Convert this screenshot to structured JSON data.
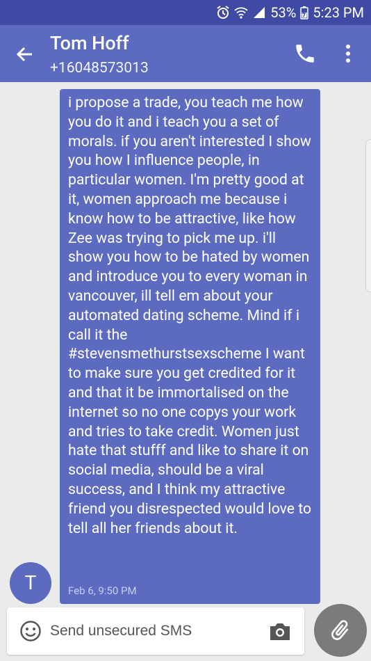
{
  "status_bar": {
    "battery": "53%",
    "time": "5:23 PM",
    "icons": [
      "alarm-icon",
      "wifi-icon",
      "signal-icon",
      "battery-icon"
    ]
  },
  "app_bar": {
    "contact_name": "Tom Hoff",
    "phone_number": "+16048573013",
    "icons": [
      "back-arrow-icon",
      "phone-icon",
      "more-vert-icon"
    ]
  },
  "message": {
    "text": "i propose a trade, you teach me how you do it and i teach you a set of morals. if you aren't interested I show you how I influence people, in particular women. I'm pretty good at it, women approach me because i know how to be attractive, like how Zee was trying to pick me up. i'll show you how to be hated by women and introduce you to every woman in vancouver, ill tell em about your automated dating scheme. Mind if i call it the #stevensmethurstsexscheme I want to make sure you get credited for it and that it be immortalised on the internet so no one copys your work and tries to take credit. Women just hate that stufff and like to share it on social media, should be a viral success, and I think my attractive friend you disrespected would love to tell all her friends about it.",
    "timestamp": "Feb 6, 9:50 PM",
    "avatar_letter": "T"
  },
  "composer": {
    "placeholder": "Send unsecured SMS",
    "icons": [
      "emoji-icon",
      "camera-icon",
      "paperclip-icon"
    ]
  },
  "colors": {
    "status_bar": "#3f4aa4",
    "app_bar": "#5c6bc0",
    "bubble": "#5c6bc0",
    "background": "#ebebeb",
    "attach_button": "#7b7b7b"
  }
}
